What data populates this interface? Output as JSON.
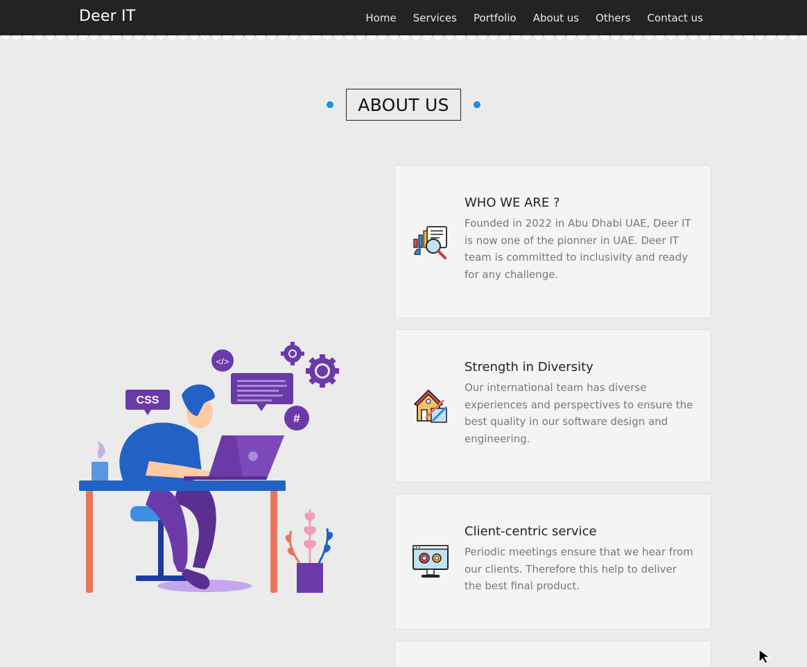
{
  "nav": {
    "brand": "Deer IT",
    "links": [
      "Home",
      "Services",
      "Portfolio",
      "About us",
      "Others",
      "Contact us"
    ]
  },
  "section": {
    "heading": "ABOUT US"
  },
  "illustration": {
    "css_label": "CSS",
    "code_label": "</>",
    "hash_label": "#"
  },
  "cards": [
    {
      "icon": "analytics-icon",
      "title": "WHO WE ARE ?",
      "desc": "Founded in 2022 in Abu Dhabi UAE, Deer IT is now one of the pionner in UAE. Deer IT team is committed to inclusivity and ready for any challenge."
    },
    {
      "icon": "house-design-icon",
      "title": "Strength in Diversity",
      "desc": "Our international team has diverse experiences and perspectives to ensure the best quality in our software design and engineering."
    },
    {
      "icon": "monitor-gears-icon",
      "title": "Client-centric service",
      "desc": "Periodic meetings ensure that we hear from our clients. Therefore this help to deliver the best final product."
    }
  ],
  "colors": {
    "navbar": "#232323",
    "accent_dot": "#1a8fe3",
    "background": "#ebebeb",
    "card": "#f4f4f4"
  }
}
